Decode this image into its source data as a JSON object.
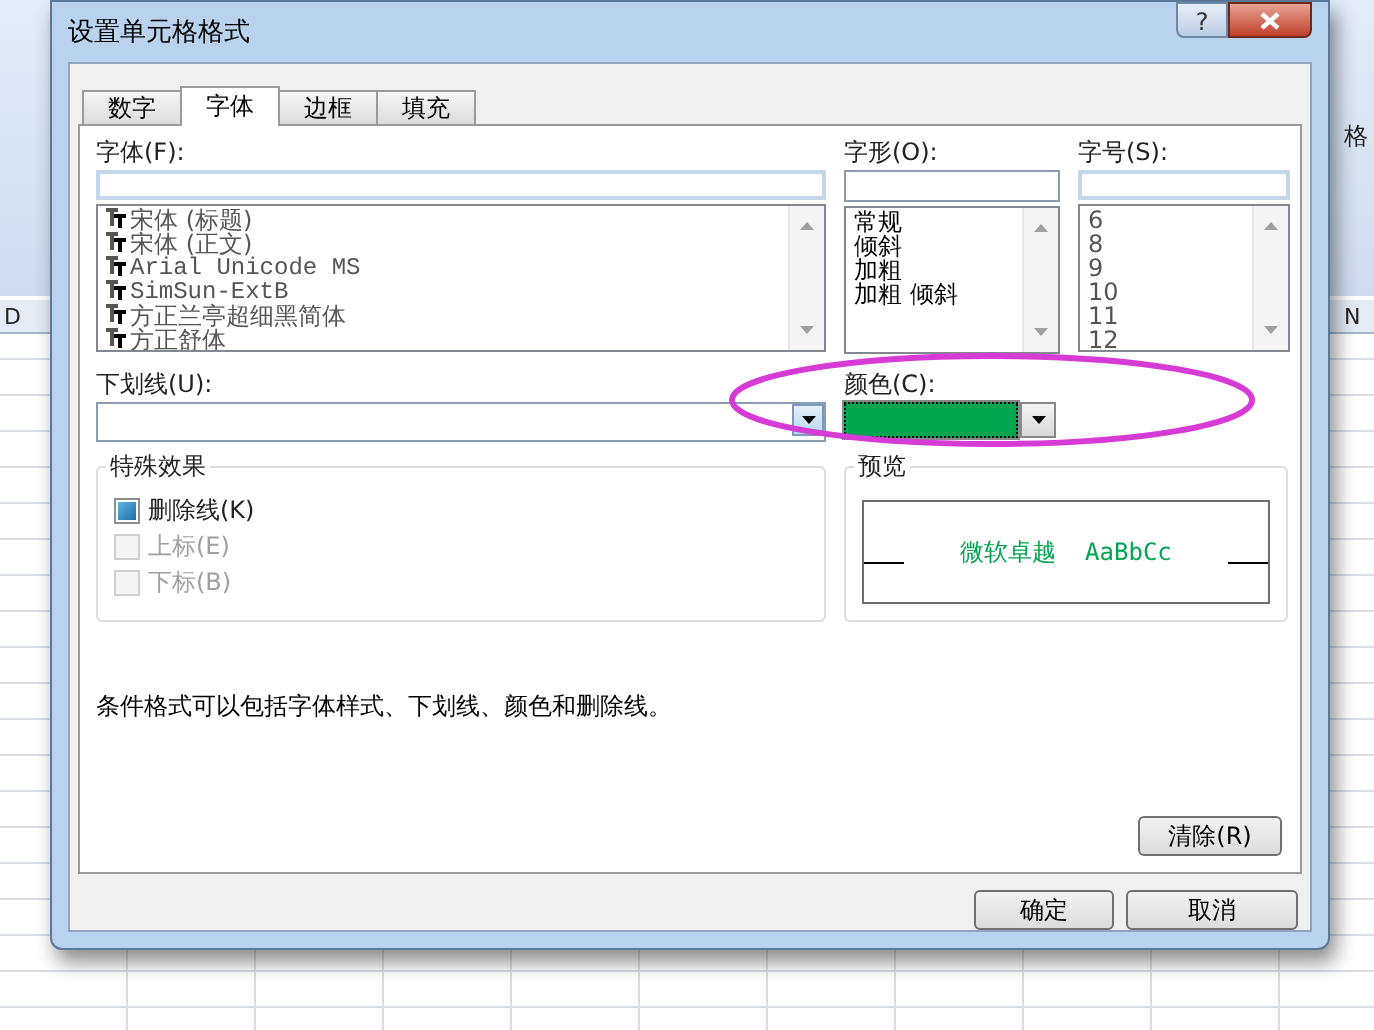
{
  "background": {
    "ribbon_label": "格",
    "column_headers": [
      "D",
      "N"
    ]
  },
  "window": {
    "title": "设置单元格格式",
    "help_button": "?"
  },
  "tabs": [
    {
      "label": "数字",
      "selected": false
    },
    {
      "label": "字体",
      "selected": true
    },
    {
      "label": "边框",
      "selected": false
    },
    {
      "label": "填充",
      "selected": false
    }
  ],
  "font": {
    "label": "字体(F):",
    "items": [
      {
        "label": "宋体 (标题)",
        "kind": "truetype",
        "mono": false
      },
      {
        "label": "宋体 (正文)",
        "kind": "truetype",
        "mono": false
      },
      {
        "label": "Arial Unicode MS",
        "kind": "truetype",
        "mono": true
      },
      {
        "label": "SimSun-ExtB",
        "kind": "truetype",
        "mono": true
      },
      {
        "label": "方正兰亭超细黑简体",
        "kind": "truetype",
        "mono": false
      },
      {
        "label": "方正舒体",
        "kind": "truetype",
        "mono": false
      }
    ]
  },
  "style": {
    "label": "字形(O):",
    "items": [
      "常规",
      "倾斜",
      "加粗",
      "加粗 倾斜"
    ]
  },
  "size": {
    "label": "字号(S):",
    "items": [
      "6",
      "8",
      "9",
      "10",
      "11",
      "12"
    ]
  },
  "underline": {
    "label": "下划线(U):"
  },
  "color": {
    "label": "颜色(C):",
    "color": "#00a550"
  },
  "effects": {
    "title": "特殊效果",
    "options": [
      {
        "label": "删除线(K)",
        "checked": true,
        "disabled": false
      },
      {
        "label": "上标(E)",
        "checked": false,
        "disabled": true
      },
      {
        "label": "下标(B)",
        "checked": false,
        "disabled": true
      }
    ]
  },
  "preview": {
    "title": "预览",
    "sample": "微软卓越  AaBbCc"
  },
  "note": "条件格式可以包括字体样式、下划线、颜色和删除线。",
  "clear_button": "清除(R)",
  "buttons": [
    "确定",
    "取消"
  ]
}
